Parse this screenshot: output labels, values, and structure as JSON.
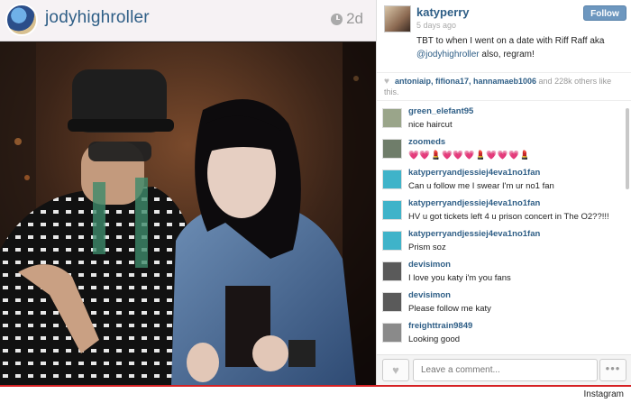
{
  "post": {
    "poster_username": "jodyhighroller",
    "time_ago": "2d",
    "photo_description": ""
  },
  "panel": {
    "username": "katyperry",
    "posted_ago": "5 days ago",
    "follow_label": "Follow",
    "caption_text": "TBT to when I went on a date with Riff Raff aka",
    "caption_mention": "@jodyhighroller",
    "caption_tail": " also, regram!",
    "likes_names": "antoniaip, fifiona17, hannamaeb1006",
    "likes_rest": " and 228k others like this."
  },
  "comments": [
    {
      "user": "green_elefant95",
      "text": "nice haircut",
      "emoji": false,
      "avatar_color": "#9aa58a"
    },
    {
      "user": "zoomeds",
      "text": "💗💗💄💗💗💗💄💗💗💗💄",
      "emoji": true,
      "avatar_color": "#6f7d6a"
    },
    {
      "user": "katyperryandjessiej4eva1no1fan",
      "text": "Can u follow me I swear I'm ur no1 fan",
      "emoji": false,
      "avatar_color": "#3fb3c9"
    },
    {
      "user": "katyperryandjessiej4eva1no1fan",
      "text": "HV u got tickets left 4 u prison concert in The O2??!!!",
      "emoji": false,
      "avatar_color": "#3fb3c9"
    },
    {
      "user": "katyperryandjessiej4eva1no1fan",
      "text": "Prism soz",
      "emoji": false,
      "avatar_color": "#3fb3c9"
    },
    {
      "user": "devisimon",
      "text": "I love you katy i'm you fans",
      "emoji": false,
      "avatar_color": "#5a5a5a"
    },
    {
      "user": "devisimon",
      "text": "Please follow me katy",
      "emoji": false,
      "avatar_color": "#5a5a5a"
    },
    {
      "user": "freighttrain9849",
      "text": "Looking good",
      "emoji": false,
      "avatar_color": "#8a8a8a"
    }
  ],
  "footer": {
    "comment_placeholder": "Leave a comment...",
    "more_label": "•••"
  },
  "watermark": "Instagram",
  "colors": {
    "username_blue": "#2e5e86",
    "follow_button": "#6d97bf",
    "accent_red": "#d62124"
  }
}
